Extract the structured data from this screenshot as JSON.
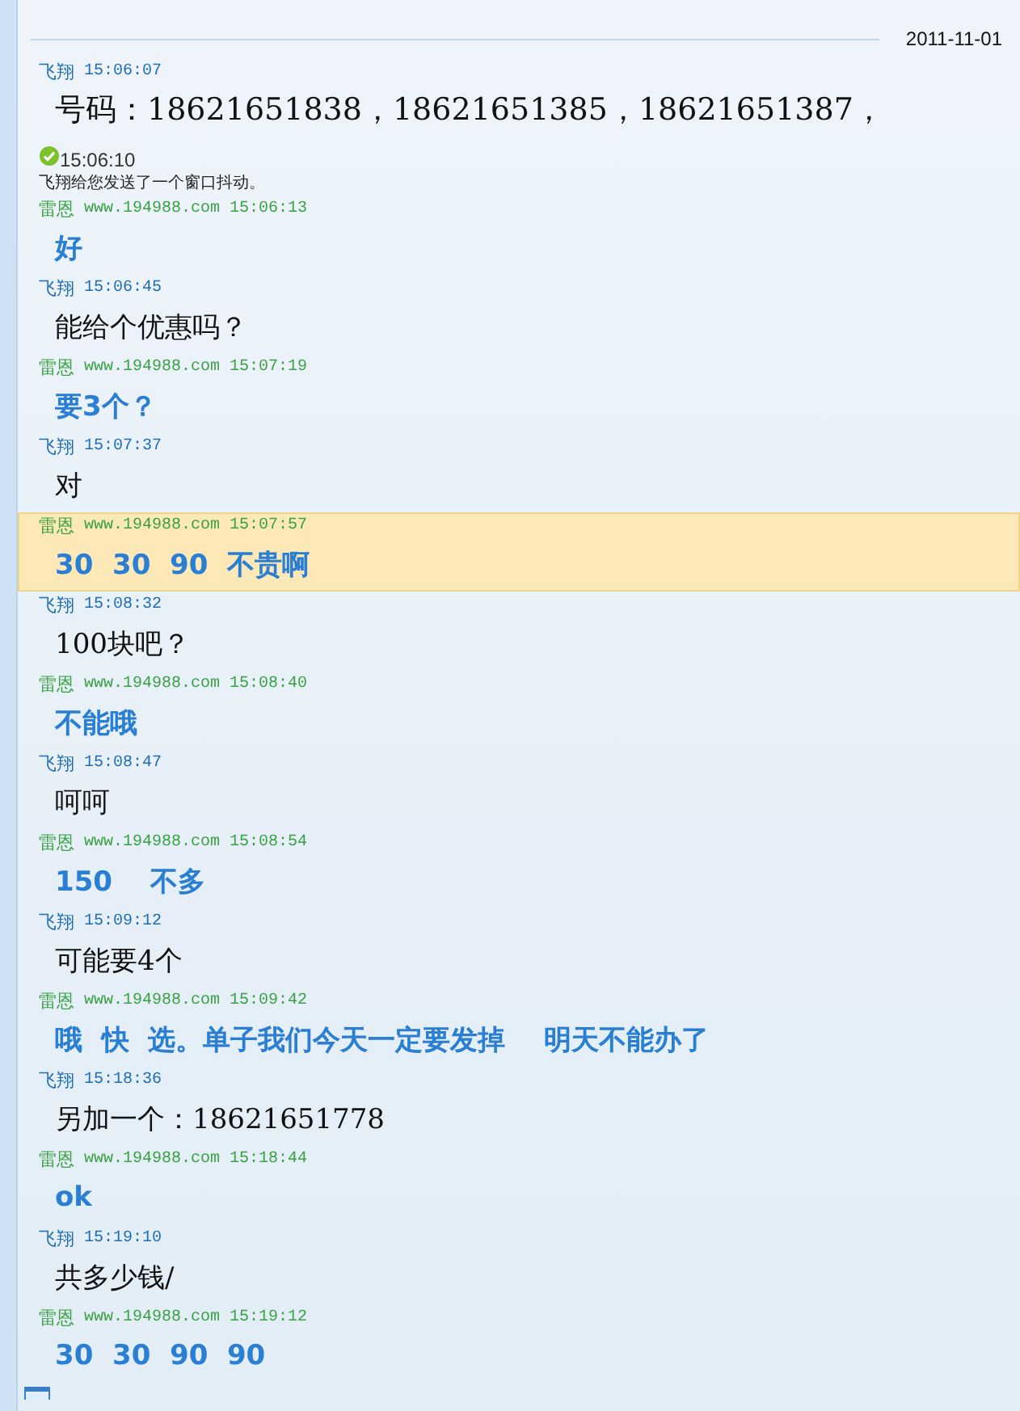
{
  "date": "2011-11-01",
  "messages": [
    {
      "kind": "buyer",
      "sender": "飞翔",
      "time": "15:06:07",
      "text": "号码：18621651838，18621651385，18621651387，",
      "selected": false
    },
    {
      "kind": "system",
      "time": "15:06:10",
      "text": "飞翔给您发送了一个窗口抖动。",
      "selected": false
    },
    {
      "kind": "seller",
      "sender": "雷恩",
      "site": "www.194988.com",
      "time": "15:06:13",
      "text": "好",
      "selected": false
    },
    {
      "kind": "buyer",
      "sender": "飞翔",
      "time": "15:06:45",
      "text": "能给个优惠吗？",
      "selected": false
    },
    {
      "kind": "seller",
      "sender": "雷恩",
      "site": "www.194988.com",
      "time": "15:07:19",
      "text": "要3个？",
      "selected": false
    },
    {
      "kind": "buyer",
      "sender": "飞翔",
      "time": "15:07:37",
      "text": "对",
      "selected": false
    },
    {
      "kind": "seller",
      "sender": "雷恩",
      "site": "www.194988.com",
      "time": "15:07:57",
      "text": "30  30  90  不贵啊",
      "selected": true
    },
    {
      "kind": "buyer",
      "sender": "飞翔",
      "time": "15:08:32",
      "text": "100块吧？",
      "selected": false
    },
    {
      "kind": "seller",
      "sender": "雷恩",
      "site": "www.194988.com",
      "time": "15:08:40",
      "text": "不能哦",
      "selected": false
    },
    {
      "kind": "buyer",
      "sender": "飞翔",
      "time": "15:08:47",
      "text": "呵呵",
      "selected": false
    },
    {
      "kind": "seller",
      "sender": "雷恩",
      "site": "www.194988.com",
      "time": "15:08:54",
      "text": "150    不多",
      "selected": false
    },
    {
      "kind": "buyer",
      "sender": "飞翔",
      "time": "15:09:12",
      "text": "可能要4个",
      "selected": false
    },
    {
      "kind": "seller",
      "sender": "雷恩",
      "site": "www.194988.com",
      "time": "15:09:42",
      "text": "哦  快  选。单子我们今天一定要发掉    明天不能办了",
      "selected": false
    },
    {
      "kind": "buyer",
      "sender": "飞翔",
      "time": "15:18:36",
      "text": "另加一个：18621651778",
      "selected": false
    },
    {
      "kind": "seller",
      "sender": "雷恩",
      "site": "www.194988.com",
      "time": "15:18:44",
      "text": "ok",
      "selected": false
    },
    {
      "kind": "buyer",
      "sender": "飞翔",
      "time": "15:19:10",
      "text": "共多少钱/",
      "selected": false
    },
    {
      "kind": "seller",
      "sender": "雷恩",
      "site": "www.194988.com",
      "time": "15:19:12",
      "text": "30  30  90  90",
      "selected": false
    }
  ]
}
